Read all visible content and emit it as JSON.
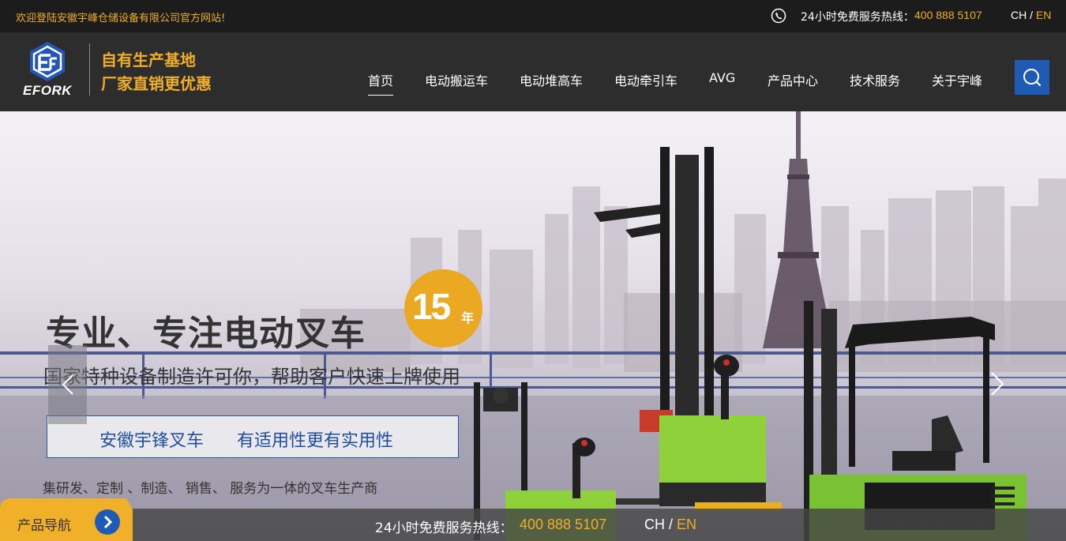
{
  "topbar": {
    "welcome": "欢迎登陆安徽宇峰仓储设备有限公司官方网站!",
    "hotline_label": "24小时免费服务热线：",
    "hotline_number": "400 888 5107",
    "lang_ch": "CH",
    "lang_sep": "/",
    "lang_en": "EN"
  },
  "header": {
    "logo_text": "EFORK",
    "slogan_line1": "自有生产基地",
    "slogan_line2": "厂家直销更优惠",
    "nav": [
      "首页",
      "电动搬运车",
      "电动堆高车",
      "电动牵引车",
      "AVG",
      "产品中心",
      "技术服务",
      "关于宇峰"
    ],
    "active_nav": "首页"
  },
  "banner": {
    "headline": "专业、专注电动叉车",
    "badge_number": "15",
    "badge_unit": "年",
    "subline": "国家特种设备制造许可你，帮助客户快速上牌使用",
    "tag1": "安徽宇锋叉车",
    "tag2": "有适用性更有实用性",
    "description": "集研发、定制 、制造、 销售、 服务为一体的叉车生产商"
  },
  "bottombar": {
    "hotline_label": "24小时免费服务热线：",
    "hotline_number": "400 888 5107",
    "lang_ch": "CH",
    "lang_sep": "/",
    "lang_en": "EN"
  },
  "product_nav": {
    "label": "产品导航"
  },
  "colors": {
    "accent": "#f0ad2a",
    "brand_blue": "#1f5bb5",
    "forklift_green": "#8fd13a",
    "topbar_bg": "#1c1c1c",
    "header_bg": "#2d2d2d"
  },
  "icons": [
    "phone-icon",
    "search-icon",
    "chevron-left-icon",
    "chevron-right-icon",
    "arrow-right-circle-icon"
  ]
}
